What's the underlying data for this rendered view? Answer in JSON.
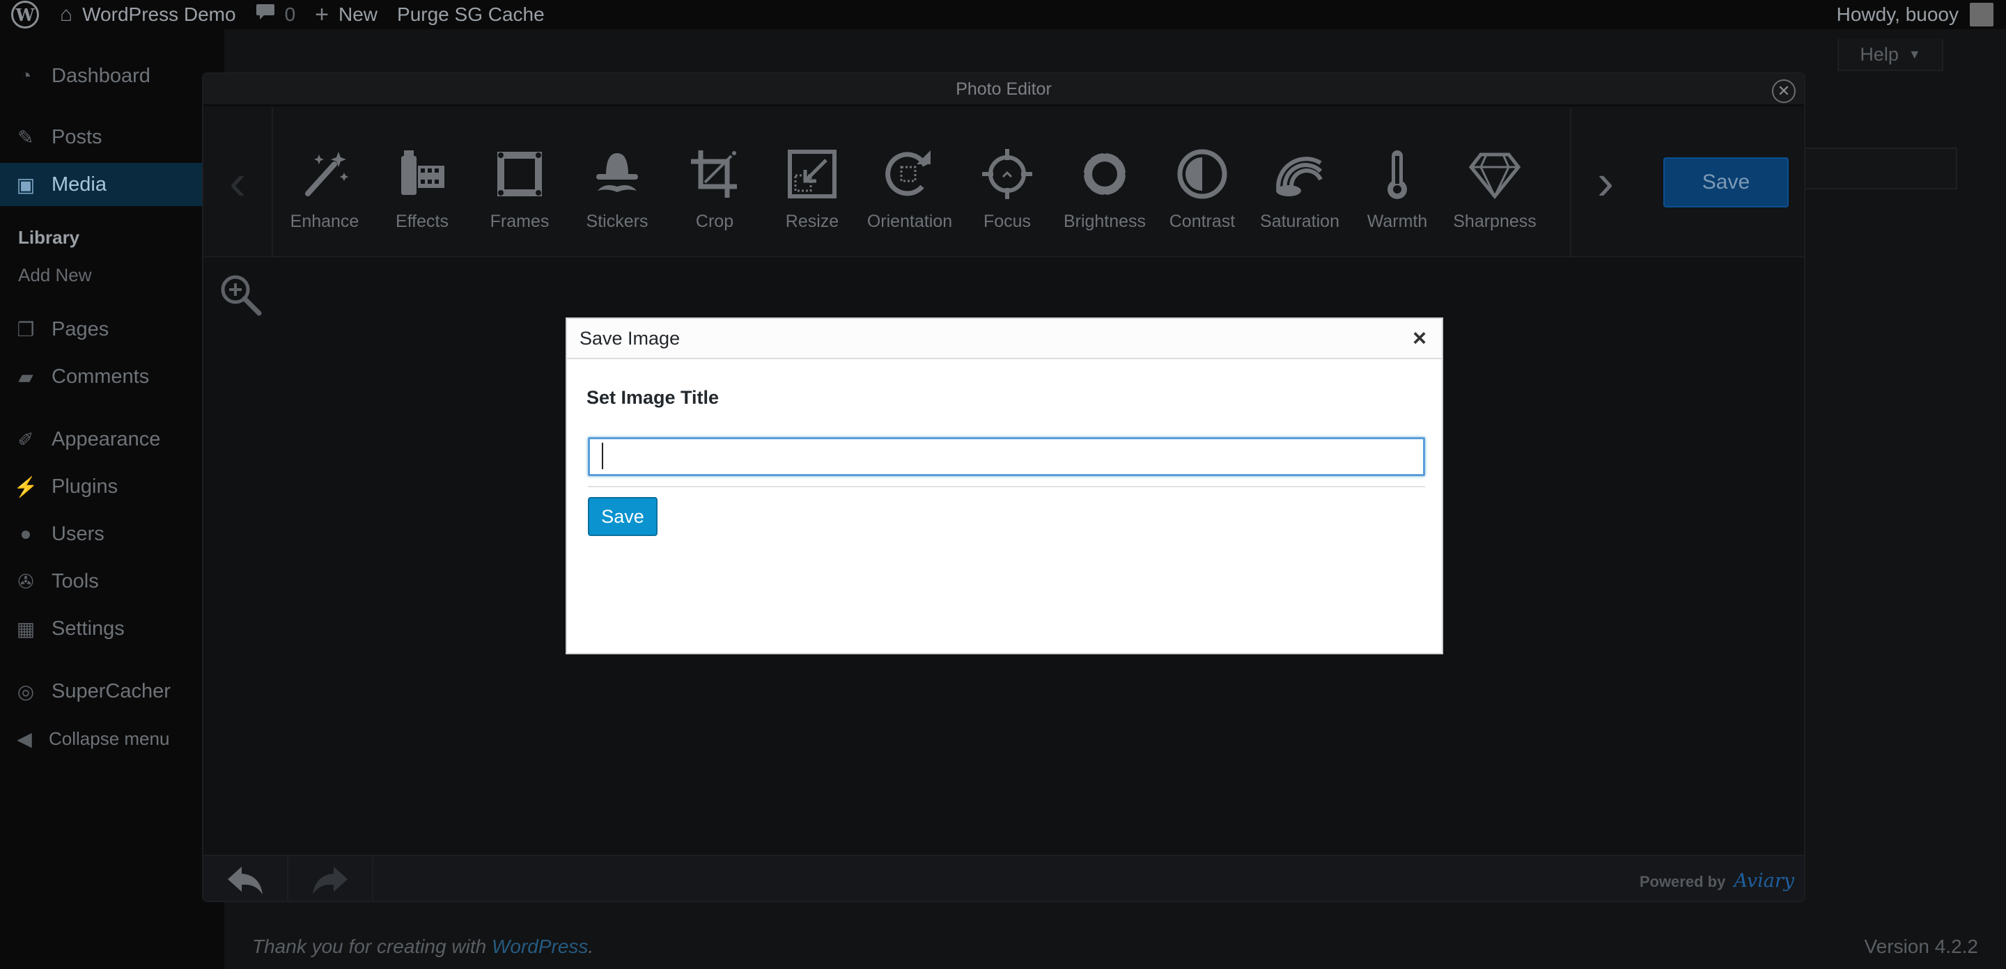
{
  "admin_bar": {
    "site_name": "WordPress Demo",
    "comments_count": "0",
    "new_label": "New",
    "purge_label": "Purge SG Cache",
    "greeting": "Howdy, buooy"
  },
  "sidebar": {
    "items": [
      {
        "label": "Dashboard",
        "icon": "dashboard-icon"
      },
      {
        "label": "Posts",
        "icon": "pin-icon"
      },
      {
        "label": "Media",
        "icon": "media-icon",
        "current": true
      },
      {
        "label": "Pages",
        "icon": "pages-icon"
      },
      {
        "label": "Comments",
        "icon": "comment-icon"
      },
      {
        "label": "Appearance",
        "icon": "brush-icon"
      },
      {
        "label": "Plugins",
        "icon": "plug-icon"
      },
      {
        "label": "Users",
        "icon": "user-icon"
      },
      {
        "label": "Tools",
        "icon": "wrench-icon"
      },
      {
        "label": "Settings",
        "icon": "settings-icon"
      },
      {
        "label": "SuperCacher",
        "icon": "supercacher-icon"
      }
    ],
    "submenu": [
      {
        "label": "Library",
        "active": true
      },
      {
        "label": "Add New"
      }
    ],
    "collapse_label": "Collapse menu"
  },
  "wp_page": {
    "help_label": "Help",
    "footer_text": "Thank you for creating with",
    "footer_link": "WordPress",
    "footer_period": ".",
    "version": "Version 4.2.2"
  },
  "photo_editor": {
    "title": "Photo Editor",
    "save_label": "Save",
    "tools": [
      {
        "label": "Enhance",
        "icon": "magic-wand-icon"
      },
      {
        "label": "Effects",
        "icon": "film-icon"
      },
      {
        "label": "Frames",
        "icon": "frame-icon"
      },
      {
        "label": "Stickers",
        "icon": "mustache-hat-icon"
      },
      {
        "label": "Crop",
        "icon": "crop-icon"
      },
      {
        "label": "Resize",
        "icon": "resize-icon"
      },
      {
        "label": "Orientation",
        "icon": "rotate-icon"
      },
      {
        "label": "Focus",
        "icon": "crosshair-icon"
      },
      {
        "label": "Brightness",
        "icon": "sun-icon"
      },
      {
        "label": "Contrast",
        "icon": "contrast-icon"
      },
      {
        "label": "Saturation",
        "icon": "rainbow-icon"
      },
      {
        "label": "Warmth",
        "icon": "thermometer-icon"
      },
      {
        "label": "Sharpness",
        "icon": "diamond-icon"
      }
    ],
    "powered_by": "Powered by",
    "powered_brand": "Aviary"
  },
  "save_dialog": {
    "title": "Save Image",
    "close_symbol": "×",
    "field_label": "Set Image Title",
    "input_value": "",
    "save_label": "Save"
  },
  "colors": {
    "dialog_button": "#0a93cf",
    "editor_save": "#0a3f72",
    "media_highlight": "#0a2a40",
    "aviary_brand": "#1f5fa0"
  }
}
